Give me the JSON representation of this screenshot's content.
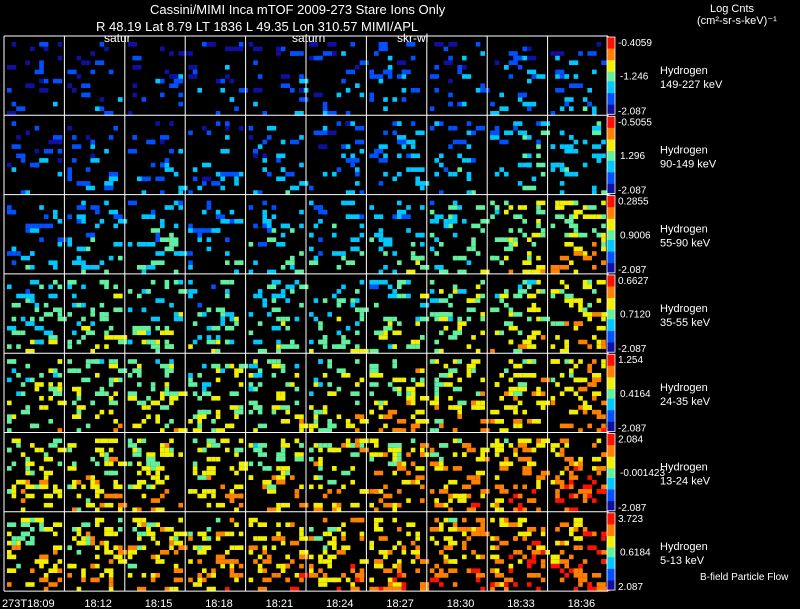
{
  "header": {
    "title": "Cassini/MIMI Inca mTOF  2009-273   Stare    Ions Only",
    "subtitle": "R       48.19 Lat 8.79 LT 1836 L          49.35 Lon          310.57  MIMI/APL",
    "image_labels": [
      "satur",
      "saturn",
      "skr-wl"
    ]
  },
  "units": {
    "title": "Log Cnts",
    "subtitle": "(cm²-sr-s-keV)⁻¹"
  },
  "footer_note": "B-field Particle Flow",
  "chart_data": {
    "type": "heatmap",
    "title": "Cassini/MIMI Inca mTOF  2009-273   Stare    Ions Only",
    "time_labels": [
      "273T18:09",
      "18:12",
      "18:15",
      "18:18",
      "18:21",
      "18:24",
      "18:27",
      "18:30",
      "18:33",
      "18:36"
    ],
    "colormap": [
      "#1010a0",
      "#0050ff",
      "#00c8ff",
      "#60f0a0",
      "#f0f000",
      "#ff8000",
      "#ff1000"
    ],
    "rows": [
      {
        "species": "Hydrogen",
        "energy": "149-227 keV",
        "scale_max": "-0.4059",
        "scale_mid": "-1.246",
        "scale_min": "-2.087",
        "activity": [
          0.05,
          0.08,
          0.08,
          0.08,
          0.1,
          0.12,
          0.18,
          0.15,
          0.15,
          0.2
        ]
      },
      {
        "species": "Hydrogen",
        "energy": "90-149 keV",
        "scale_max": "-0.5055",
        "scale_mid": "1.296",
        "scale_min": "-2.087",
        "activity": [
          0.12,
          0.15,
          0.15,
          0.15,
          0.18,
          0.18,
          0.25,
          0.25,
          0.3,
          0.35
        ]
      },
      {
        "species": "Hydrogen",
        "energy": "55-90 keV",
        "scale_max": "0.2855",
        "scale_mid": "0.9006",
        "scale_min": "-2.087",
        "activity": [
          0.2,
          0.3,
          0.3,
          0.25,
          0.3,
          0.3,
          0.35,
          0.4,
          0.55,
          0.6
        ]
      },
      {
        "species": "Hydrogen",
        "energy": "35-55 keV",
        "scale_max": "0.6627",
        "scale_mid": "0.7120",
        "scale_min": "-2.087",
        "activity": [
          0.4,
          0.45,
          0.45,
          0.4,
          0.4,
          0.42,
          0.45,
          0.5,
          0.55,
          0.62
        ]
      },
      {
        "species": "Hydrogen",
        "energy": "24-35 keV",
        "scale_max": "1.254",
        "scale_mid": "0.4164",
        "scale_min": "-2.087",
        "activity": [
          0.5,
          0.55,
          0.55,
          0.52,
          0.52,
          0.55,
          0.6,
          0.6,
          0.65,
          0.7
        ]
      },
      {
        "species": "Hydrogen",
        "energy": "13-24 keV",
        "scale_max": "2.084",
        "scale_mid": "-0.001423",
        "scale_min": "-2.087",
        "activity": [
          0.6,
          0.62,
          0.62,
          0.62,
          0.62,
          0.65,
          0.68,
          0.7,
          0.72,
          0.78
        ]
      },
      {
        "species": "Hydrogen",
        "energy": "5-13 keV",
        "scale_max": "3.723",
        "scale_mid": "0.6184",
        "scale_min": "2.087",
        "activity": [
          0.65,
          0.68,
          0.68,
          0.68,
          0.68,
          0.7,
          0.72,
          0.75,
          0.78,
          0.82
        ]
      }
    ]
  }
}
